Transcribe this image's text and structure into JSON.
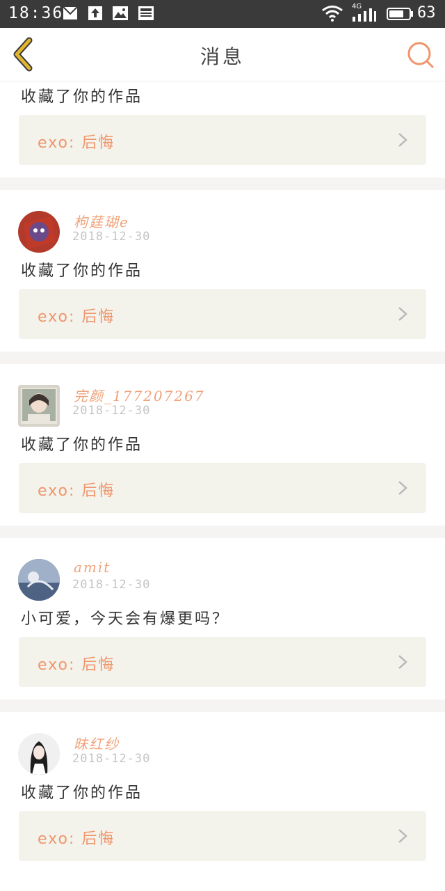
{
  "status_bar": {
    "time": "18:36",
    "network": "4G",
    "battery": "63"
  },
  "header": {
    "title": "消息"
  },
  "messages": [
    {
      "text": "收藏了你的作品",
      "work": "exo: 后悔"
    },
    {
      "username": "枸莛瑚e",
      "date": "2018-12-30",
      "text": "收藏了你的作品",
      "work": "exo: 后悔",
      "avatar_color": "#b23a2a"
    },
    {
      "username": "完颜_177207267",
      "date": "2018-12-30",
      "text": "收藏了你的作品",
      "work": "exo: 后悔",
      "avatar_color": "#d8d3c8"
    },
    {
      "username": "amit",
      "date": "2018-12-30",
      "text": "小可爱，今天会有爆更吗？",
      "work": "exo: 后悔",
      "avatar_color": "#5a6f8c"
    },
    {
      "username": "昧红纱",
      "date": "2018-12-30",
      "text": "收藏了你的作品",
      "work": "exo: 后悔",
      "avatar_color": "#e8e8e8"
    }
  ],
  "colors": {
    "accent": "#f0956b",
    "back_arrow": "#e2b530",
    "card_bg": "#f3f3ec",
    "status_bar_bg": "#3a3a3a"
  }
}
